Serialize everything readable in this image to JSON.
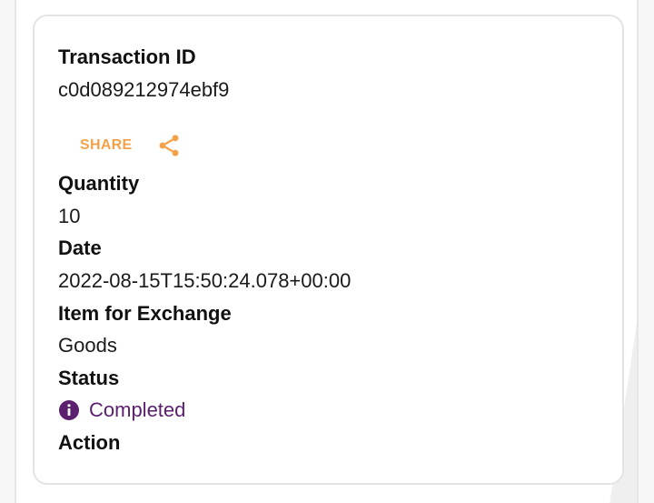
{
  "transaction": {
    "id_label": "Transaction ID",
    "id_value": "c0d089212974ebf9",
    "share_label": "SHARE",
    "share_icon": "share-icon",
    "quantity_label": "Quantity",
    "quantity_value": "10",
    "date_label": "Date",
    "date_value": "2022-08-15T15:50:24.078+00:00",
    "item_label": "Item for Exchange",
    "item_value": "Goods",
    "status_label": "Status",
    "status_icon": "info-icon",
    "status_value": "Completed",
    "action_label": "Action"
  },
  "colors": {
    "accent": "#f4a24a",
    "status": "#5b1f6e"
  }
}
